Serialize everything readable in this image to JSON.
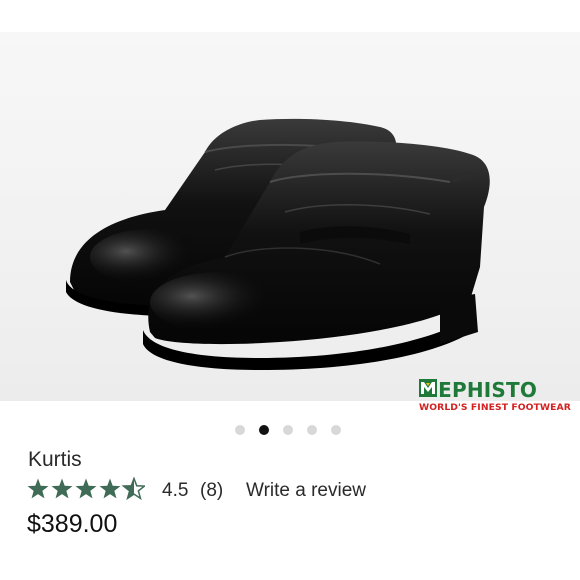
{
  "product": {
    "name": "Kurtis",
    "rating": "4.5",
    "review_count": "(8)",
    "rating_value": 4.5,
    "rating_max": 5,
    "write_review_label": "Write a review",
    "price": "$389.00"
  },
  "gallery": {
    "image_count": 5,
    "active_index": 1,
    "image_icon": "black-penny-loafer-pair"
  },
  "brand": {
    "name": "MEPHISTO",
    "tagline": "WORLD'S FINEST FOOTWEAR",
    "name_color": "#1f7a3a",
    "tagline_color": "#d32121"
  },
  "colors": {
    "star": "#3f6b57",
    "text": "#2a2a2a",
    "dot_active": "#111111",
    "dot_inactive": "#d8d8d8"
  }
}
